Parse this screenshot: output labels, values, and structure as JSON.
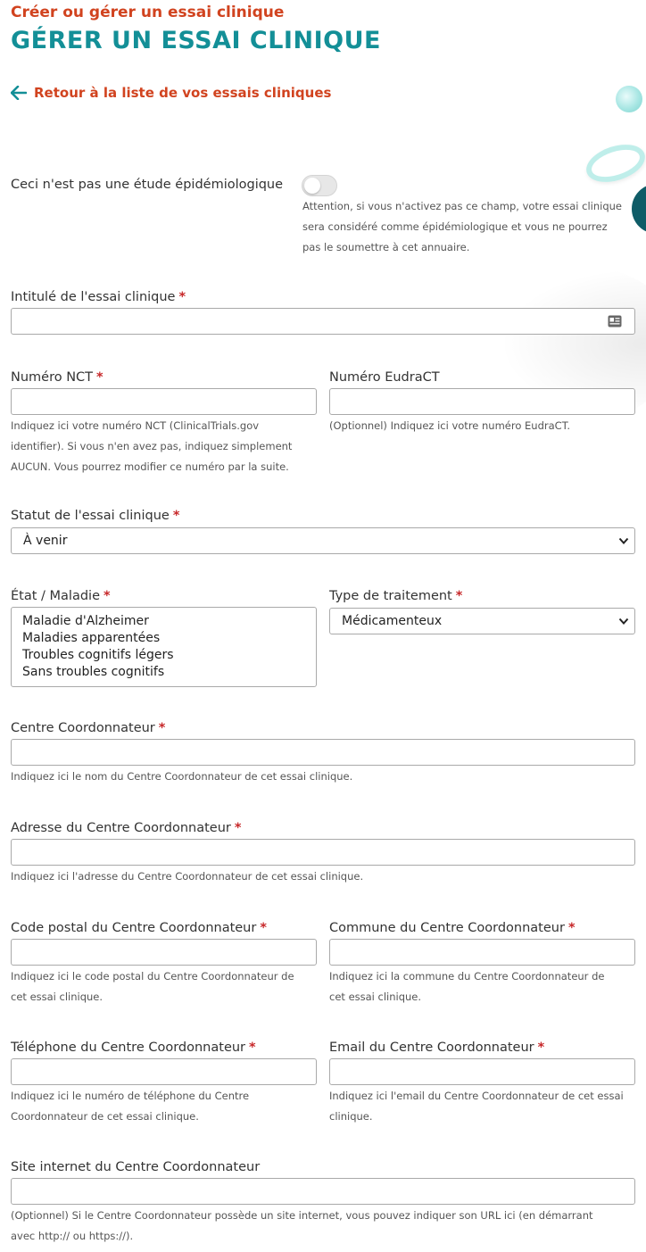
{
  "header": {
    "kicker": "Créer ou gérer un essai clinique",
    "title": "GÉRER UN ESSAI CLINIQUE",
    "back_link": "Retour à la liste de vos essais cliniques"
  },
  "epidemio": {
    "label": "Ceci n'est pas une étude épidémiologique",
    "enabled": false,
    "help": [
      "Attention, si vous n'activez pas ce champ, votre essai clinique",
      "sera considéré comme épidémiologique et vous ne pourrez",
      "pas le soumettre à cet annuaire."
    ]
  },
  "required_mark": "*",
  "fields": {
    "title": {
      "label": "Intitulé de l'essai clinique",
      "value": ""
    },
    "nct": {
      "label": "Numéro NCT",
      "value": "",
      "help": [
        "Indiquez ici votre numéro NCT (ClinicalTrials.gov",
        "identifier). Si vous n'en avez pas, indiquez simplement",
        "AUCUN. Vous pourrez modifier ce numéro par la suite."
      ]
    },
    "eudract": {
      "label": "Numéro EudraCT",
      "value": "",
      "help": "(Optionnel) Indiquez ici votre numéro EudraCT."
    },
    "status": {
      "label": "Statut de l'essai clinique",
      "selected": "À venir"
    },
    "condition": {
      "label": "État / Maladie",
      "options": [
        "Maladie d'Alzheimer",
        "Maladies apparentées",
        "Troubles cognitifs légers",
        "Sans troubles cognitifs"
      ]
    },
    "treatment": {
      "label": "Type de traitement",
      "selected": "Médicamenteux"
    },
    "center": {
      "label": "Centre Coordonnateur",
      "value": "",
      "help": "Indiquez ici le nom du Centre Coordonnateur de cet essai clinique."
    },
    "address": {
      "label": "Adresse du Centre Coordonnateur",
      "value": "",
      "help": "Indiquez ici l'adresse du Centre Coordonnateur de cet essai clinique."
    },
    "postal": {
      "label": "Code postal du Centre Coordonnateur",
      "value": "",
      "help": [
        "Indiquez ici le code postal du Centre Coordonnateur de",
        "cet essai clinique."
      ]
    },
    "city": {
      "label": "Commune du Centre Coordonnateur",
      "value": "",
      "help": [
        "Indiquez ici la commune du Centre Coordonnateur de",
        "cet essai clinique."
      ]
    },
    "phone": {
      "label": "Téléphone du Centre Coordonnateur",
      "value": "",
      "help": [
        "Indiquez ici le numéro de téléphone du Centre",
        "Coordonnateur de cet essai clinique."
      ]
    },
    "email": {
      "label": "Email du Centre Coordonnateur",
      "value": "",
      "help": [
        "Indiquez ici l'email du Centre Coordonnateur de cet essai",
        "clinique."
      ]
    },
    "website": {
      "label": "Site internet du Centre Coordonnateur",
      "value": "",
      "help": [
        "(Optionnel) Si le Centre Coordonnateur possède un site internet, vous pouvez indiquer son URL ici (en démarrant",
        "avec http:// ou https://)."
      ]
    }
  },
  "colors": {
    "accent_orange": "#d1431f",
    "accent_teal": "#138f97",
    "required": "#c7282a"
  },
  "icons": {
    "back": "arrow-left-icon",
    "title_field": "contact-card-icon",
    "select": "chevron-down-icon"
  }
}
